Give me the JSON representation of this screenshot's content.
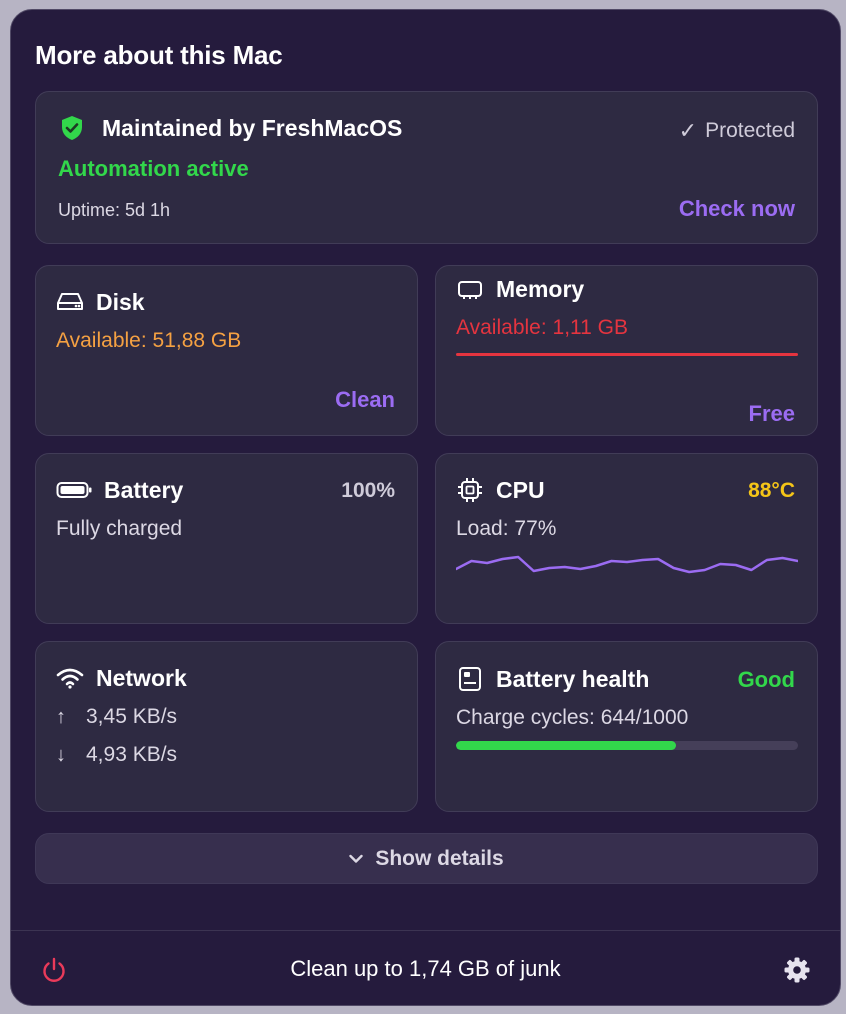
{
  "title": "More about this Mac",
  "maintenance": {
    "heading": "Maintained by FreshMacOS",
    "status": "Protected",
    "automation": "Automation active",
    "uptime": "Uptime: 5d 1h",
    "action": "Check now",
    "shield_color": "#32d74b"
  },
  "disk": {
    "heading": "Disk",
    "available": "Available: 51,88 GB",
    "action": "Clean",
    "accent": "#f5a142"
  },
  "memory": {
    "heading": "Memory",
    "available": "Available: 1,11 GB",
    "action": "Free",
    "accent": "#e5343f"
  },
  "battery": {
    "heading": "Battery",
    "percent": "100%",
    "status": "Fully charged"
  },
  "cpu": {
    "heading": "CPU",
    "temperature": "88°C",
    "load": "Load: 77%",
    "temp_color": "#f5c518",
    "load_history": [
      70,
      78,
      76,
      80,
      82,
      68,
      71,
      72,
      70,
      73,
      78,
      77,
      79,
      80,
      71,
      67,
      69,
      75,
      74,
      69,
      79,
      81,
      78
    ]
  },
  "network": {
    "heading": "Network",
    "upload": "3,45 KB/s",
    "download": "4,93 KB/s"
  },
  "battery_health": {
    "heading": "Battery health",
    "rating": "Good",
    "cycles": "Charge cycles: 644/1000",
    "cycle_fraction": 0.644,
    "rating_color": "#32d74b"
  },
  "details_toggle": "Show details",
  "footer": {
    "message": "Clean up to 1,74 GB of junk"
  },
  "icons": [
    "shield-icon",
    "checkmark-icon",
    "disk-icon",
    "memory-icon",
    "battery-icon",
    "cpu-icon",
    "wifi-icon",
    "arrow-up-icon",
    "arrow-down-icon",
    "battery-health-icon",
    "chevron-down-icon",
    "power-icon",
    "gear-icon"
  ]
}
